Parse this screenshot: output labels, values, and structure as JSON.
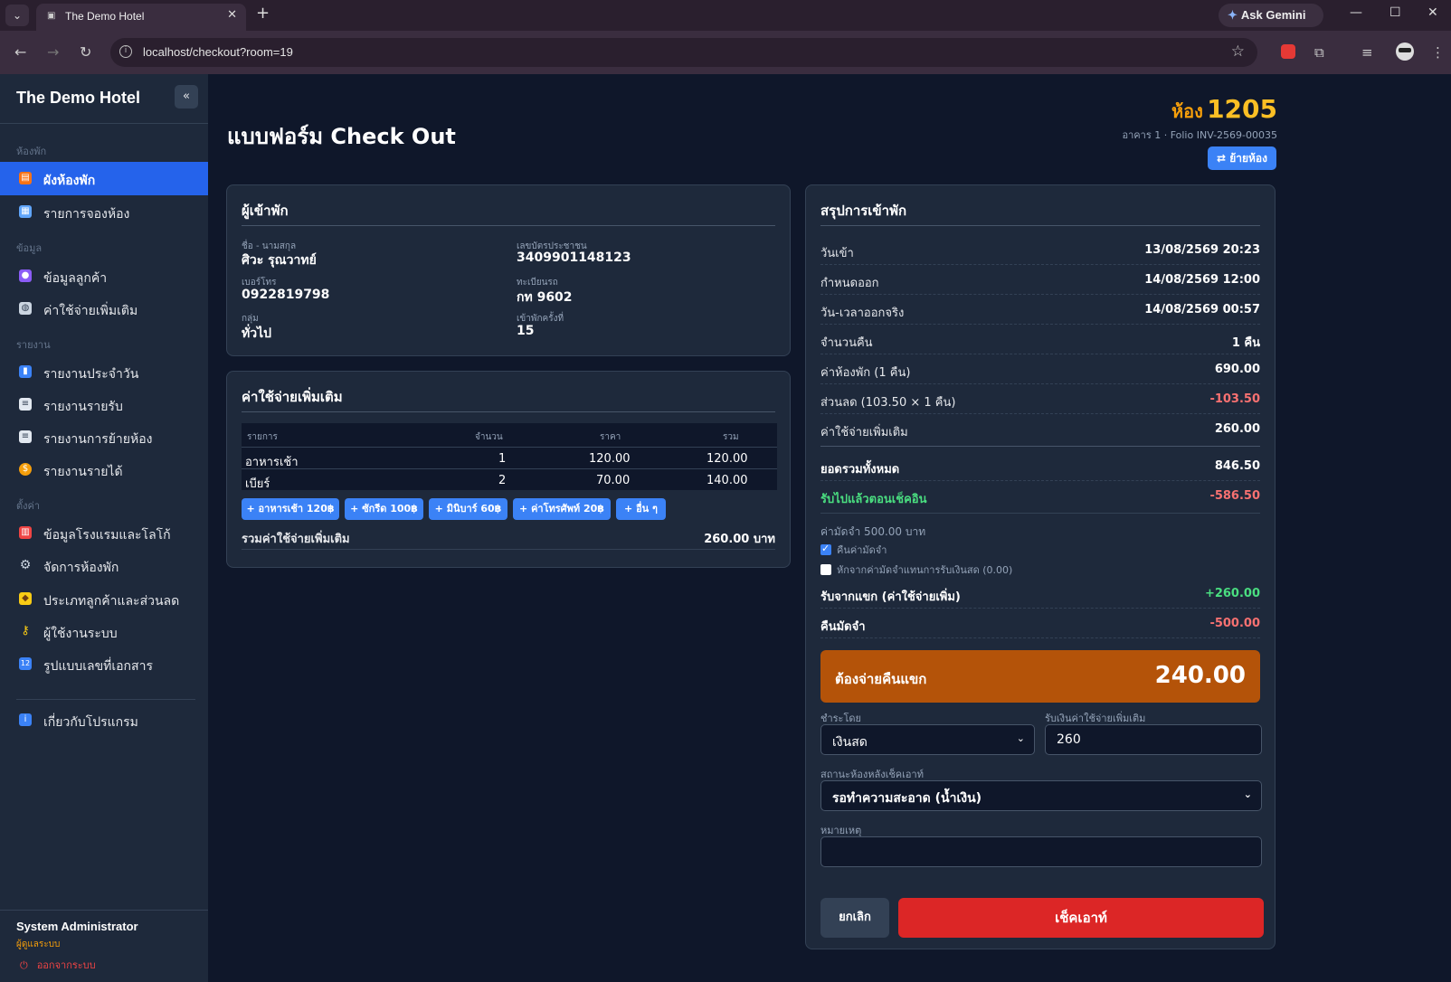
{
  "browser": {
    "tab_title": "The Demo Hotel",
    "new_tab": "+",
    "url": "localhost/checkout?room=19",
    "gemini_label": "Ask Gemini"
  },
  "sidebar": {
    "brand": "The Demo Hotel",
    "collapse": "«",
    "sections": [
      {
        "label": "ห้องพัก"
      },
      {
        "label": "ข้อมูล"
      },
      {
        "label": "รายงาน"
      },
      {
        "label": "ตั้งค่า"
      }
    ],
    "items": [
      {
        "label": "ผังห้องพัก",
        "icon": "hotel-icon"
      },
      {
        "label": "รายการจองห้อง",
        "icon": "calendar-icon"
      },
      {
        "label": "ข้อมูลลูกค้า",
        "icon": "users-icon"
      },
      {
        "label": "ค่าใช้จ่ายเพิ่มเติม",
        "icon": "dish-icon"
      },
      {
        "label": "รายงานประจำวัน",
        "icon": "chart-icon"
      },
      {
        "label": "รายงานรายรับ",
        "icon": "ledger-icon"
      },
      {
        "label": "รายงานการย้ายห้อง",
        "icon": "ledger-icon"
      },
      {
        "label": "รายงานรายได้",
        "icon": "money-bag-icon"
      },
      {
        "label": "ข้อมูลโรงแรมและโลโก้",
        "icon": "building-icon"
      },
      {
        "label": "จัดการห้องพัก",
        "icon": "gear-icon"
      },
      {
        "label": "ประเภทลูกค้าและส่วนลด",
        "icon": "tag-icon"
      },
      {
        "label": "ผู้ใช้งานระบบ",
        "icon": "key-icon"
      },
      {
        "label": "รูปแบบเลขที่เอกสาร",
        "icon": "numbers-icon"
      },
      {
        "label": "เกี่ยวกับโปรแกรม",
        "icon": "info-icon"
      }
    ],
    "user_name": "System Administrator",
    "user_role": "ผู้ดูแลระบบ",
    "logout": "ออกจากระบบ"
  },
  "header": {
    "title": "แบบฟอร์ม Check Out",
    "room_label": "ห้อง",
    "room_number": "1205",
    "room_sub": "อาคาร 1 · Folio INV-2569-00035",
    "move_button": "⇄ ย้ายห้อง"
  },
  "guest": {
    "title": "ผู้เข้าพัก",
    "fields": [
      {
        "label": "ชื่อ - นามสกุล",
        "value": "ศิวะ รุณวาทย์"
      },
      {
        "label": "เลขบัตรประชาชน",
        "value": "3409901148123"
      },
      {
        "label": "เบอร์โทร",
        "value": "0922819798"
      },
      {
        "label": "ทะเบียนรถ",
        "value": "กท 9602"
      },
      {
        "label": "กลุ่ม",
        "value": "ทั่วไป"
      },
      {
        "label": "เข้าพักครั้งที่",
        "value": "15"
      }
    ]
  },
  "expenses": {
    "title": "ค่าใช้จ่ายเพิ่มเติม",
    "columns": [
      "รายการ",
      "จำนวน",
      "ราคา",
      "รวม"
    ],
    "rows": [
      {
        "item": "อาหารเช้า",
        "qty": "1",
        "price": "120.00",
        "total": "120.00"
      },
      {
        "item": "เบียร์",
        "qty": "2",
        "price": "70.00",
        "total": "140.00"
      }
    ],
    "quick_buttons": [
      "+ อาหารเช้า 120฿",
      "+ ซักรีด 100฿",
      "+ มินิบาร์ 60฿",
      "+ ค่าโทรศัพท์ 20฿",
      "+ อื่น ๆ"
    ],
    "total_label": "รวมค่าใช้จ่ายเพิ่มเติม",
    "total_value": "260.00 บาท"
  },
  "summary": {
    "title": "สรุปการเข้าพัก",
    "rows": [
      {
        "label": "วันเข้า",
        "value": "13/08/2569 20:23"
      },
      {
        "label": "กำหนดออก",
        "value": "14/08/2569 12:00"
      },
      {
        "label": "วัน-เวลาออกจริง",
        "value": "14/08/2569 00:57"
      },
      {
        "label": "จำนวนคืน",
        "value": "1 คืน"
      },
      {
        "label": "ค่าห้องพัก (1 คืน)",
        "value": "690.00"
      },
      {
        "label": "ส่วนลด (103.50 × 1 คืน)",
        "value": "-103.50"
      },
      {
        "label": "ค่าใช้จ่ายเพิ่มเติม",
        "value": "260.00"
      }
    ],
    "grand_total_label": "ยอดรวมทั้งหมด",
    "grand_total_value": "846.50",
    "received_label": "รับไปแล้วตอนเช็คอิน",
    "received_value": "-586.50",
    "deposit_title": "ค่ามัดจำ 500.00 บาท",
    "refund_deposit_label": "คืนค่ามัดจำ",
    "deduct_deposit_label": "หักจากค่ามัดจำแทนการรับเงินสด (0.00)",
    "collect_label": "รับจากแขก (ค่าใช้จ่ายเพิ่ม)",
    "collect_value": "+260.00",
    "deposit_return_label": "คืนมัดจำ",
    "deposit_return_value": "-500.00",
    "pay_label": "ต้องจ่ายคืนแขก",
    "pay_value": "240.00",
    "pay_by_label": "ชำระโดย",
    "pay_by_value": "เงินสด",
    "extra_received_label": "รับเงินค่าใช้จ่ายเพิ่มเติม",
    "extra_received_value": "260",
    "room_status_label": "สถานะห้องหลังเช็คเอาท์",
    "room_status_value": "รอทำความสะอาด (น้ำเงิน)",
    "note_label": "หมายเหตุ",
    "note_value": "",
    "cancel_button": "ยกเลิก",
    "checkout_button": "เช็คเอาท์"
  },
  "colors": {
    "accent": "#2563eb",
    "warning": "#b45309",
    "danger": "#dc2626",
    "room_number": "#fbbf24"
  }
}
